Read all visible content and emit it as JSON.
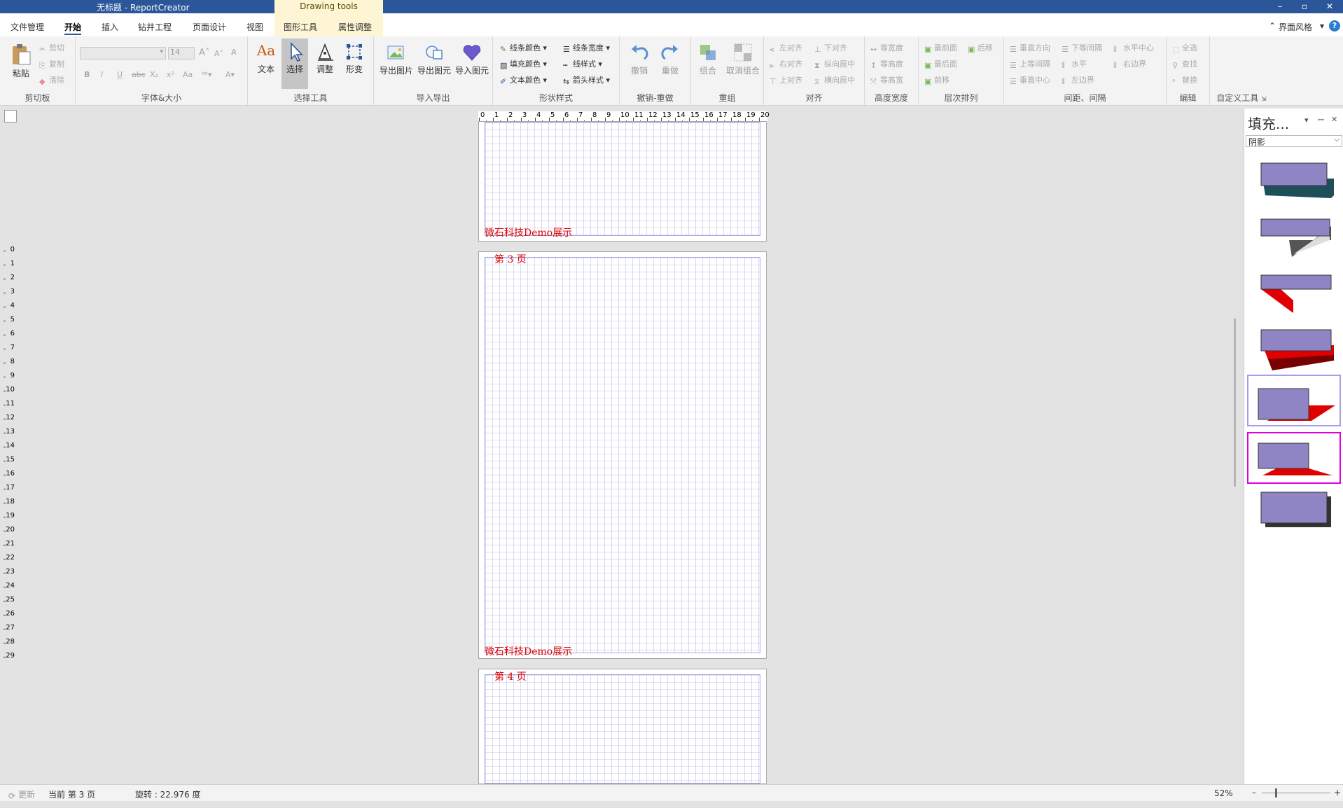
{
  "titlebar": {
    "title": "无标题 - ReportCreator",
    "contextual": "Drawing tools",
    "min": "–",
    "max": "▫",
    "close": "✕"
  },
  "tabs": [
    "文件管理",
    "开始",
    "插入",
    "钻井工程",
    "页面设计",
    "视图",
    "图形工具",
    "属性调整"
  ],
  "ui_style": "界面风格",
  "help": "?",
  "ribbon": {
    "clipboard": {
      "paste": "粘贴",
      "cut": "剪切",
      "copy": "复制",
      "clear": "清除",
      "label": "剪切板"
    },
    "font": {
      "size": "14",
      "label": "字体&大小",
      "bold": "B",
      "italic": "I",
      "underline": "U",
      "strike": "abc",
      "sub": "X₂",
      "sup": "x²",
      "case": "Aa",
      "grow": "A",
      "shrink": "A"
    },
    "select": {
      "text": "文本",
      "select": "选择",
      "adjust": "调整",
      "transform": "形变",
      "label": "选择工具"
    },
    "io": {
      "export_img": "导出图片",
      "export_elem": "导出图元",
      "import_elem": "导入图元",
      "label": "导入导出"
    },
    "shape": {
      "line_color": "线条颜色",
      "fill_color": "填充颜色",
      "text_color": "文本颜色",
      "line_width": "线条宽度",
      "line_style": "线样式",
      "arrow_style": "箭头样式",
      "label": "形状样式"
    },
    "undo": {
      "undo": "撤销",
      "redo": "重做",
      "label": "撤销-重做"
    },
    "group": {
      "group": "组合",
      "ungroup": "取消组合",
      "label": "重组"
    },
    "align": {
      "left": "左对齐",
      "right": "右对齐",
      "top": "上对齐",
      "bottom": "下对齐",
      "vcenter": "纵向居中",
      "hcenter": "横向居中",
      "label": "对齐"
    },
    "size": {
      "same_width": "等宽度",
      "same_height": "等高度",
      "same_both": "等高宽",
      "label": "高度宽度"
    },
    "order": {
      "front": "最前面",
      "back": "最后面",
      "forward": "前移",
      "backward": "后移",
      "label": "层次排列"
    },
    "spacing": {
      "vdir": "垂直方向",
      "vequal": "上等间隔",
      "vcenter": "垂直中心",
      "hequal": "下等间隔",
      "horizontal": "水平",
      "left_edge": "左边界",
      "hcenter": "水平中心",
      "right_edge": "右边界",
      "label": "间距、间隔"
    },
    "edit": {
      "select_all": "全选",
      "find": "查找",
      "replace": "替换",
      "label": "编辑"
    },
    "custom": {
      "label": "自定义工具"
    }
  },
  "ruler_h": [
    "0",
    "1",
    "2",
    "3",
    "4",
    "5",
    "6",
    "7",
    "8",
    "9",
    "10",
    "11",
    "12",
    "13",
    "14",
    "15",
    "16",
    "17",
    "18",
    "19",
    "20"
  ],
  "ruler_v": [
    "0",
    "1",
    "2",
    "3",
    "4",
    "5",
    "6",
    "7",
    "8",
    "9",
    "10",
    "11",
    "12",
    "13",
    "14",
    "15",
    "16",
    "17",
    "18",
    "19",
    "20",
    "21",
    "22",
    "23",
    "24",
    "25",
    "26",
    "27",
    "28",
    "29"
  ],
  "pages": [
    {
      "header": "",
      "footer": "微石科技Demo展示"
    },
    {
      "header": "第 3 页",
      "footer": "微石科技Demo展示"
    },
    {
      "header": "第 4 页",
      "footer": ""
    }
  ],
  "panel": {
    "title": "填充...",
    "dropdown": "阴影",
    "pin": "ꟷ",
    "close": "✕",
    "arrow": "▾"
  },
  "status": {
    "update": "更新",
    "current": "当前 第 3 页",
    "rotation": "旋转 : 22.976 度",
    "zoom": "52%",
    "minus": "–",
    "plus": "+"
  },
  "colors": {
    "accent": "#2b579a",
    "contextual": "#fdf5d4",
    "shape_fill": "#8f84c4",
    "red": "#e00000"
  }
}
